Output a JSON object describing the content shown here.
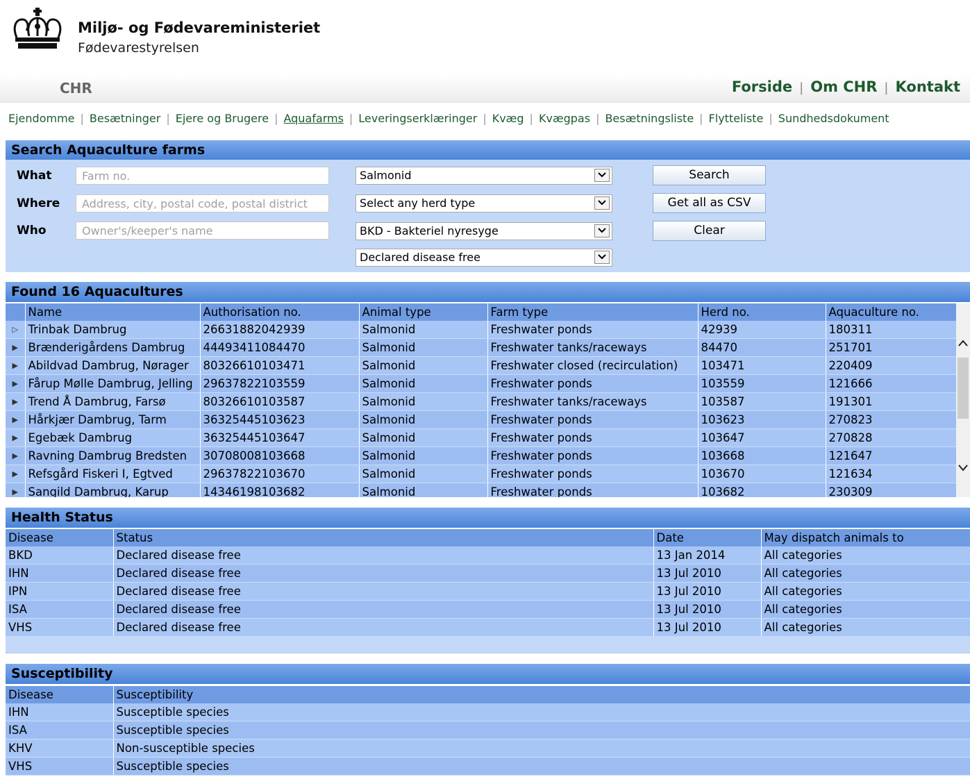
{
  "branding": {
    "ministry": "Miljø- og Fødevareministeriet",
    "agency": "Fødevarestyrelsen",
    "logo_icon": "crown-icon"
  },
  "topbar": {
    "title": "CHR",
    "links": [
      "Forside",
      "Om CHR",
      "Kontakt"
    ]
  },
  "nav": {
    "items": [
      "Ejendomme",
      "Besætninger",
      "Ejere og Brugere",
      "Aquafarms",
      "Leveringserklæringer",
      "Kvæg",
      "Kvægpas",
      "Besætningsliste",
      "Flytteliste",
      "Sundhedsdokument"
    ],
    "active": "Aquafarms"
  },
  "search": {
    "title": "Search Aquaculture farms",
    "what_label": "What",
    "where_label": "Where",
    "who_label": "Who",
    "what_placeholder": "Farm no.",
    "where_placeholder": "Address, city, postal code, postal district",
    "who_placeholder": "Owner's/keeper's name",
    "animal_type": "Salmonid",
    "herd_type": "Select any herd type",
    "disease": "BKD - Bakteriel nyresyge",
    "status": "Declared disease free",
    "search_button": "Search",
    "csv_button": "Get all as CSV",
    "clear_button": "Clear"
  },
  "farms": {
    "title": "Found 16 Aquacultures",
    "columns": [
      "Name",
      "Authorisation no.",
      "Animal type",
      "Farm type",
      "Herd no.",
      "Aquaculture no."
    ],
    "rows": [
      [
        "Trinbak Dambrug",
        "26631882042939",
        "Salmonid",
        "Freshwater ponds",
        "42939",
        "180311"
      ],
      [
        "Brænderigårdens Dambrug",
        "44493411084470",
        "Salmonid",
        "Freshwater tanks/raceways",
        "84470",
        "251701"
      ],
      [
        "Abildvad Dambrug, Nørager",
        "80326610103471",
        "Salmonid",
        "Freshwater closed (recirculation)",
        "103471",
        "220409"
      ],
      [
        "Fårup Mølle Dambrug, Jelling",
        "29637822103559",
        "Salmonid",
        "Freshwater ponds",
        "103559",
        "121666"
      ],
      [
        "Trend Å Dambrug, Farsø",
        "80326610103587",
        "Salmonid",
        "Freshwater tanks/raceways",
        "103587",
        "191301"
      ],
      [
        "Hårkjær Dambrug, Tarm",
        "36325445103623",
        "Salmonid",
        "Freshwater ponds",
        "103623",
        "270823"
      ],
      [
        "Egebæk Dambrug",
        "36325445103647",
        "Salmonid",
        "Freshwater ponds",
        "103647",
        "270828"
      ],
      [
        "Ravning Dambrug Bredsten",
        "30708008103668",
        "Salmonid",
        "Freshwater ponds",
        "103668",
        "121647"
      ],
      [
        "Refsgård Fiskeri I, Egtved",
        "29637822103670",
        "Salmonid",
        "Freshwater ponds",
        "103670",
        "121634"
      ],
      [
        "Sangild Dambrug, Karup",
        "14346198103682",
        "Salmonid",
        "Freshwater ponds",
        "103682",
        "230309"
      ]
    ]
  },
  "health": {
    "title": "Health Status",
    "columns": [
      "Disease",
      "Status",
      "Date",
      "May dispatch animals to"
    ],
    "rows": [
      [
        "BKD",
        "Declared disease free",
        "13 Jan 2014",
        "All categories"
      ],
      [
        "IHN",
        "Declared disease free",
        "13 Jul 2010",
        "All categories"
      ],
      [
        "IPN",
        "Declared disease free",
        "13 Jul 2010",
        "All categories"
      ],
      [
        "ISA",
        "Declared disease free",
        "13 Jul 2010",
        "All categories"
      ],
      [
        "VHS",
        "Declared disease free",
        "13 Jul 2010",
        "All categories"
      ]
    ]
  },
  "susceptibility": {
    "title": "Susceptibility",
    "columns": [
      "Disease",
      "Susceptibility"
    ],
    "rows": [
      [
        "IHN",
        "Susceptible species"
      ],
      [
        "ISA",
        "Susceptible species"
      ],
      [
        "KHV",
        "Non-susceptible species"
      ],
      [
        "VHS",
        "Susceptible species"
      ]
    ]
  }
}
